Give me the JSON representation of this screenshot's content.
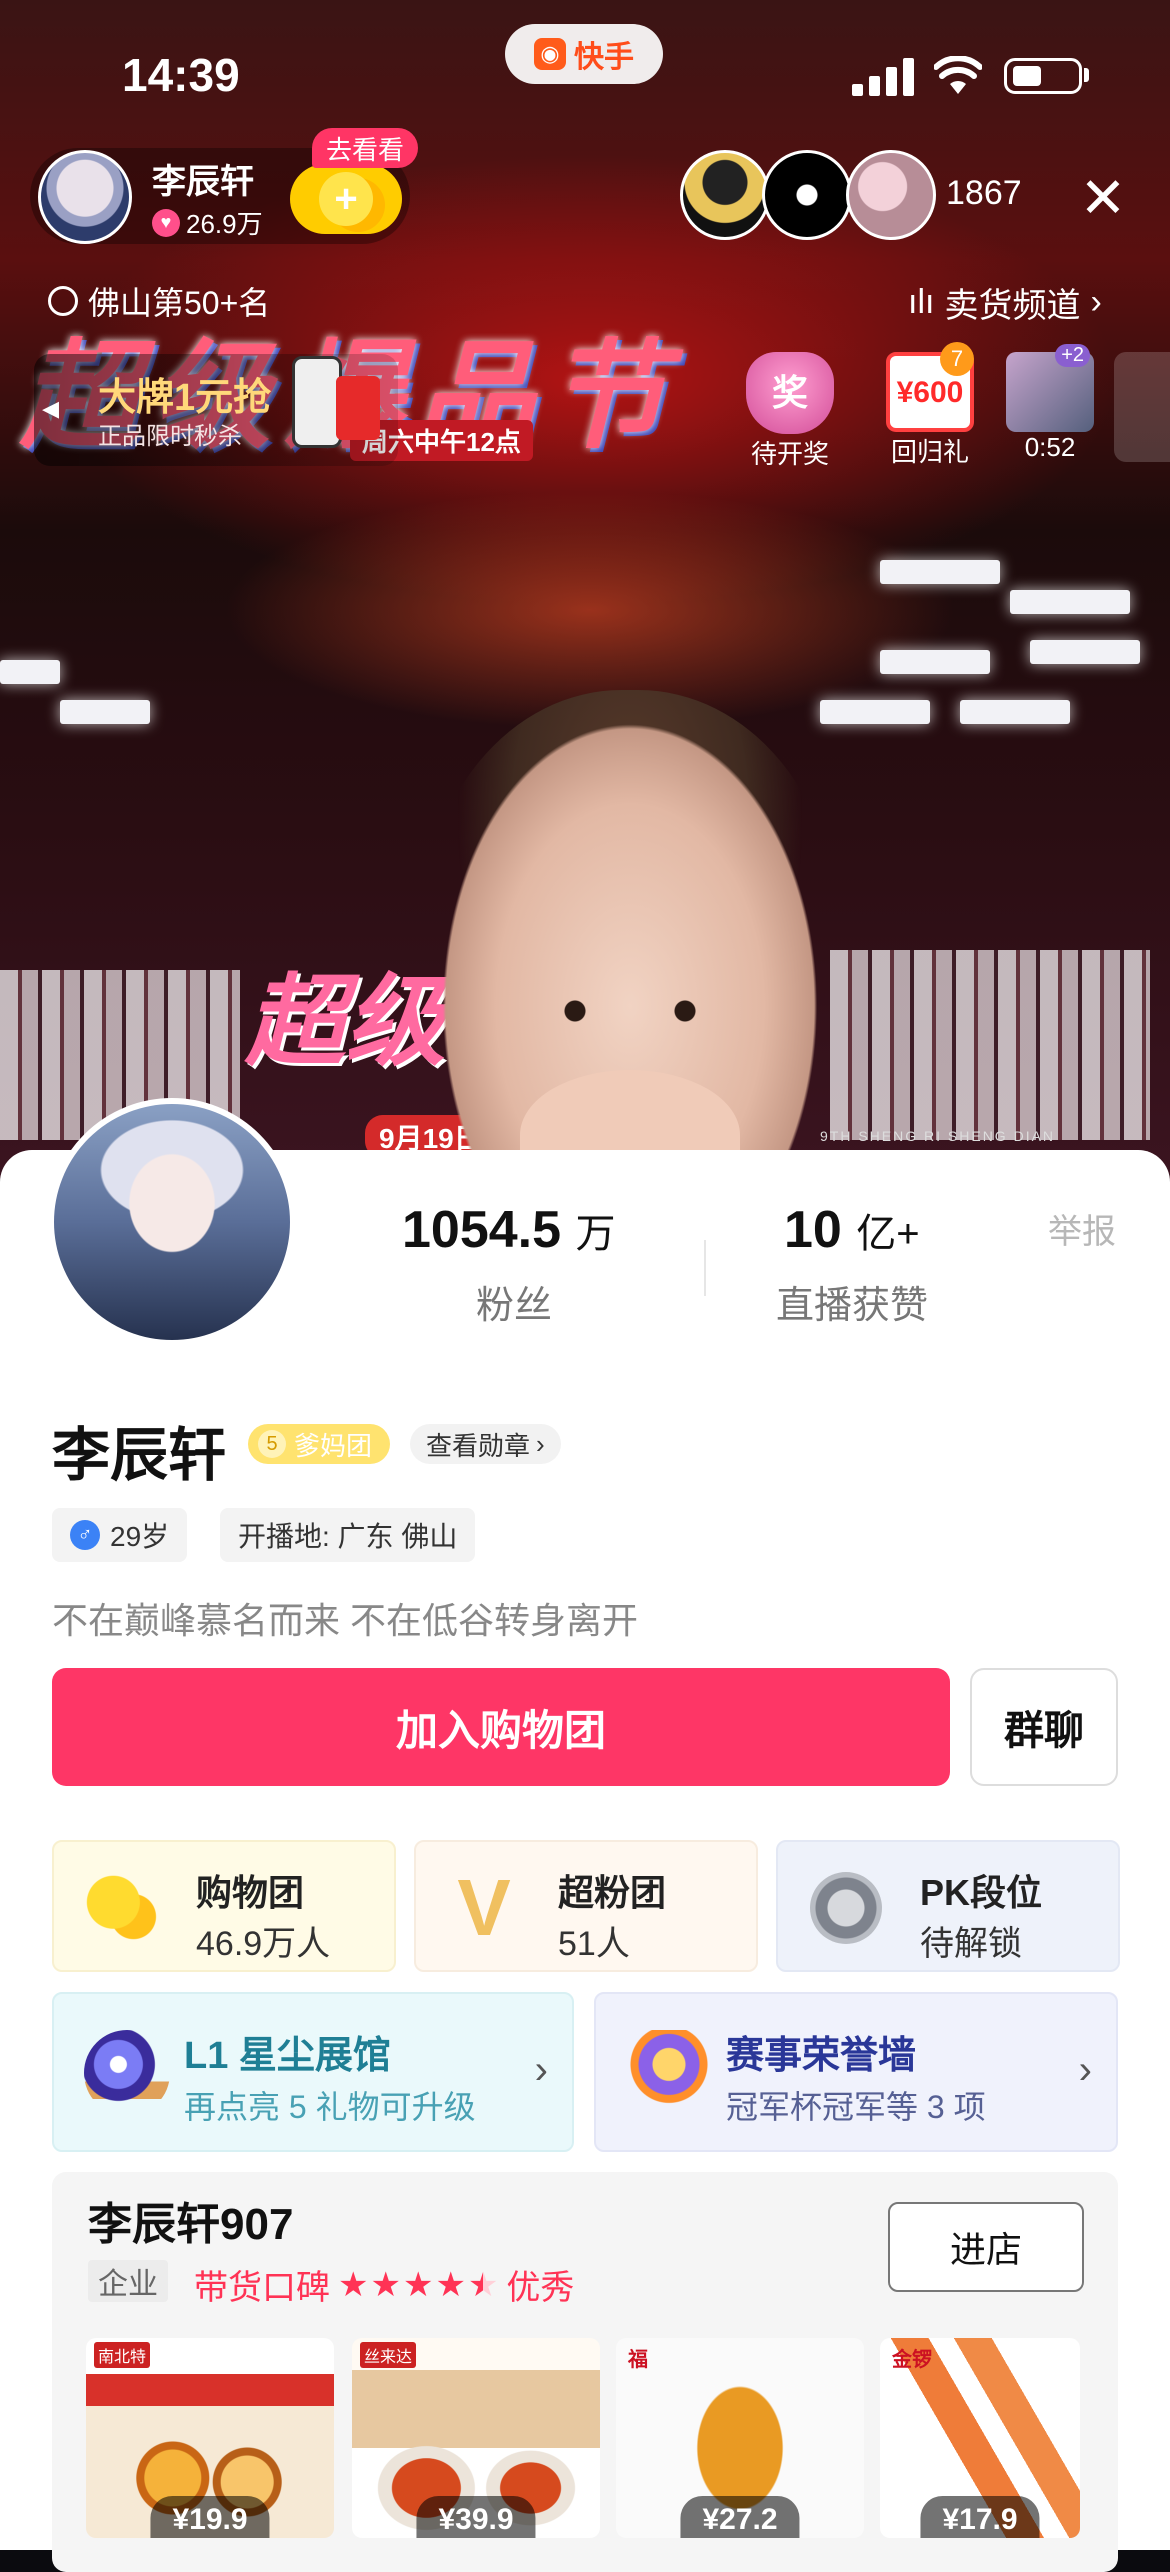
{
  "status_bar": {
    "time": "14:39",
    "app_name": "快手"
  },
  "live": {
    "host_name": "李辰轩",
    "host_likes": "26.9万",
    "go_see_label": "去看看",
    "viewer_count": "1867",
    "rank_text": "佛山第50+名",
    "channel_text": "卖货频道",
    "promo_title": "大牌1元抢",
    "promo_sub": "正品限时秒杀",
    "widgets": {
      "prize_icon_text": "奖",
      "prize_label": "待开奖",
      "return_icon_text": "¥600",
      "return_badge": "7",
      "return_label": "回归礼",
      "timer_badge": "+2",
      "timer_label": "0:52"
    },
    "background_text": {
      "banner_big": "超级爆品节",
      "banner_date": "周六中午12点",
      "banner_mid": "超级",
      "banner_date2": "9月19日",
      "shelf_text": "9TH SHENG RI SHENG DIAN"
    }
  },
  "profile": {
    "stats": [
      {
        "value": "1054.5",
        "unit": "万",
        "label": "粉丝"
      },
      {
        "value": "10",
        "unit": "亿+",
        "label": "直播获赞"
      }
    ],
    "report_label": "举报",
    "name": "李辰轩",
    "fan_group": {
      "level": "5",
      "label": "爹妈团"
    },
    "medal_link": "查看勋章",
    "age": "29岁",
    "location": "开播地: 广东 佛山",
    "bio": "不在巅峰慕名而来 不在低谷转身离开",
    "join_button": "加入购物团",
    "chat_button": "群聊",
    "tiles": [
      {
        "title": "购物团",
        "sub": "46.9万人"
      },
      {
        "title": "超粉团",
        "sub": "51人"
      },
      {
        "title": "PK段位",
        "sub": "待解锁"
      }
    ],
    "exhibit": {
      "title": "L1 星尘展馆",
      "sub": "再点亮 5 礼物可升级"
    },
    "honor": {
      "title": "赛事荣誉墙",
      "sub": "冠军杯冠军等 3 项"
    }
  },
  "store": {
    "name": "李辰轩907",
    "type": "企业",
    "reputation_label": "带货口碑",
    "rating": 4.5,
    "rating_text": "优秀",
    "enter_button": "进店",
    "products": [
      {
        "label": "南北特",
        "price": "¥19.9"
      },
      {
        "label": "丝来达",
        "price": "¥39.9"
      },
      {
        "label": "福",
        "price": "¥27.2"
      },
      {
        "label": "金锣",
        "price": "¥17.9"
      }
    ]
  },
  "colors": {
    "accent": "#fe3666",
    "fan_badge": "#ffe36f",
    "store_rating": "#ff3355"
  }
}
